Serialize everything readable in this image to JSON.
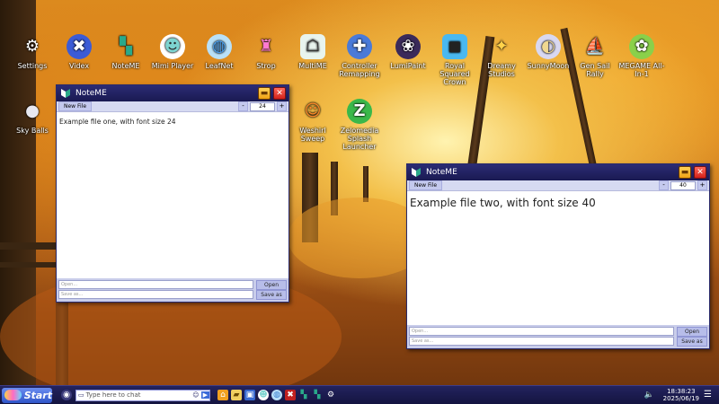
{
  "desktop": {
    "icons": [
      {
        "label": "Settings",
        "icon": "gear-icon",
        "glyph": "⚙",
        "color": "#ffffff",
        "bg": "transparent"
      },
      {
        "label": "Videx",
        "icon": "videx-icon",
        "glyph": "✖",
        "color": "#ffffff",
        "bg": "#3b5bd6"
      },
      {
        "label": "NoteME",
        "icon": "noteme-icon",
        "glyph": "▚",
        "color": "#2aa98a",
        "bg": "transparent"
      },
      {
        "label": "Mimi Player",
        "icon": "mimi-player-icon",
        "glyph": "☻",
        "color": "#7dd4d0",
        "bg": "#ffffff"
      },
      {
        "label": "LeafNet",
        "icon": "leafnet-icon",
        "glyph": "◍",
        "color": "#4aa0f0",
        "bg": "#b8e0f8"
      },
      {
        "label": "Strop",
        "icon": "strop-icon",
        "glyph": "♜",
        "color": "#ff7ad0",
        "bg": "transparent"
      },
      {
        "label": "MultiME",
        "icon": "multime-icon",
        "glyph": "☖",
        "color": "#333333",
        "bg": "#e8f4ee"
      },
      {
        "label": "Controller Remapping",
        "icon": "controller-icon",
        "glyph": "✚",
        "color": "#ffffff",
        "bg": "#4a7ad8"
      },
      {
        "label": "LumiPaint",
        "icon": "lumipaint-icon",
        "glyph": "❀",
        "color": "#ffffff",
        "bg": "#3a2a5a"
      },
      {
        "label": "Royal Squared Crown",
        "icon": "royal-squared-icon",
        "glyph": "◼",
        "color": "#222222",
        "bg": "#4ab8f0"
      },
      {
        "label": "Dreamy Studios",
        "icon": "dreamy-studios-icon",
        "glyph": "✦",
        "color": "#ffd24a",
        "bg": "transparent"
      },
      {
        "label": "SunnyMoon",
        "icon": "sunnymoon-icon",
        "glyph": "◐",
        "color": "#f0d890",
        "bg": "#d8d8f0"
      },
      {
        "label": "Gen Sail Rally",
        "icon": "gen-sail-rally-icon",
        "glyph": "⛵",
        "color": "#4a9ae8",
        "bg": "transparent"
      },
      {
        "label": "MEGAME All-In-1",
        "icon": "megame-icon",
        "glyph": "✿",
        "color": "#ffffff",
        "bg": "#8ad04a"
      },
      {
        "label": "Sky Balls",
        "icon": "sky-balls-icon",
        "glyph": "●",
        "color": "#e8e8f0",
        "bg": "transparent"
      },
      {
        "label": "Weshirl Sweep",
        "icon": "weshirl-sweep-icon",
        "glyph": "☺",
        "color": "#ff8a2a",
        "bg": "transparent"
      },
      {
        "label": "Zelomedia Splash Launcher",
        "icon": "zelomedia-icon",
        "glyph": "Z",
        "color": "#ffffff",
        "bg": "#3ab84a"
      }
    ]
  },
  "windows": [
    {
      "title": "NoteME",
      "new_file": "New File",
      "minus": "-",
      "plus": "+",
      "font_size": "24",
      "text": "Example file one, with font size 24",
      "open_placeholder": "Open...",
      "saveas_placeholder": "Save as...",
      "open_label": "Open",
      "saveas_label": "Save as"
    },
    {
      "title": "NoteME",
      "new_file": "New File",
      "minus": "-",
      "plus": "+",
      "font_size": "40",
      "text": "Example file two, with font size 40",
      "open_placeholder": "Open...",
      "saveas_placeholder": "Save as...",
      "open_label": "Open",
      "saveas_label": "Save as"
    }
  ],
  "taskbar": {
    "start_label": "Start",
    "chat_placeholder": "Type here to chat",
    "time": "18:38:23",
    "date": "2025/06/19",
    "pinned": [
      "home-icon",
      "folder-icon",
      "image-icon",
      "mimi-icon",
      "globe-icon",
      "videx-icon",
      "noteme-icon",
      "noteme-icon",
      "gear-icon"
    ]
  }
}
